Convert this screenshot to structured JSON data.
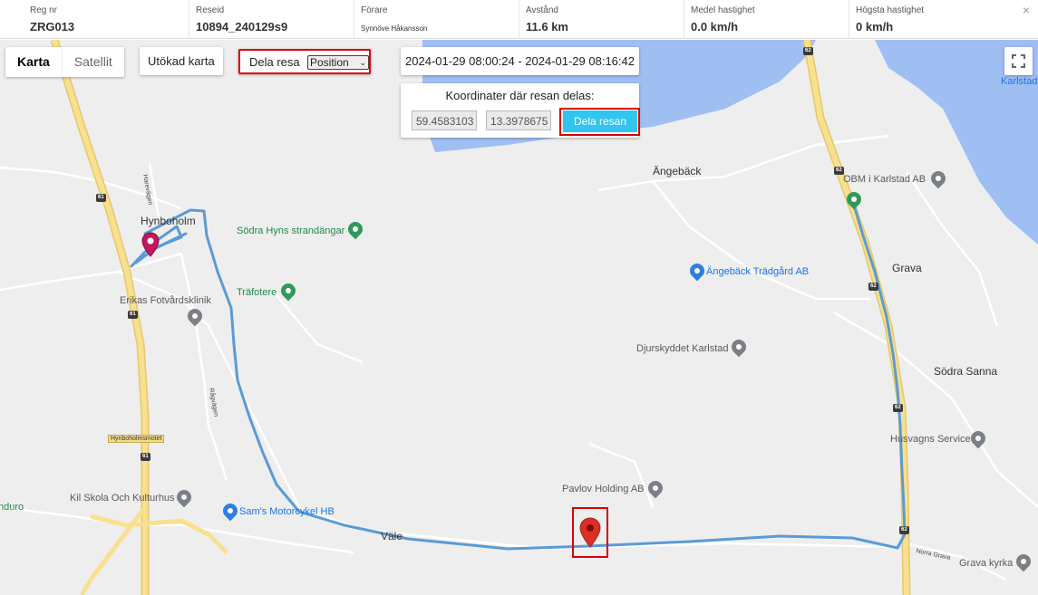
{
  "info": {
    "reg_label": "Reg nr",
    "reg_value": "ZRG013",
    "trip_label": "Reseid",
    "trip_value": "10894_240129s9",
    "driver_label": "Förare",
    "driver_value": "Synnöve Håkansson",
    "distance_label": "Avstånd",
    "distance_value": "11.6 km",
    "avg_label": "Medel hastighet",
    "avg_value": "0.0 km/h",
    "max_label": "Högsta hastighet",
    "max_value": "0 km/h",
    "close_icon": "×"
  },
  "controls": {
    "map_tab": "Karta",
    "satellite_tab": "Satellit",
    "extended_map": "Utökad karta",
    "share_label": "Dela resa",
    "share_select_value": "Position",
    "period": "2024-01-29 08:00:24 - 2024-01-29 08:16:42",
    "coord_title": "Koordinater där resan delas:",
    "lat_value": "59.4583103",
    "lng_value": "13.3978675",
    "share_trip_button": "Dela resan",
    "fullscreen_icon": "fullscreen-icon"
  },
  "map": {
    "places": {
      "hynboholm": "Hynboholm",
      "angebeck": "Ängebäck",
      "grava": "Grava",
      "sodra_sanna": "Södra Sanna",
      "vale": "Väle",
      "karlstad": "Karlstad",
      "anduro": "nduro"
    },
    "pois": {
      "strandangar": "Södra Hyns strandängar",
      "trafotere": "Träfotere",
      "erikas": "Erikas Fotvårdsklinik",
      "angebeck_tradgard": "Ängebäck Trädgård AB",
      "djurskyddet": "Djurskyddet Karlstad",
      "obm": "OBM i Karlstad AB",
      "husvagns": "Husvagns Service",
      "pavlov": "Pavlov Holding AB",
      "kil_skola": "Kil Skola Och Kulturhus",
      "sams": "Sam's Motorcykel HB",
      "grava_kyrka": "Grava kyrka"
    },
    "roads": {
      "harevagen": "Harevägen",
      "ragvagen": "Rågvägen",
      "norra_grava": "Norra Grava",
      "motet": "Hynboholmsmotet",
      "r61": "61",
      "r62": "62"
    },
    "colors": {
      "route": "#5a9bd5",
      "water": "#9fbff3",
      "highway": "#f5d470",
      "marker": "#d93025"
    }
  }
}
